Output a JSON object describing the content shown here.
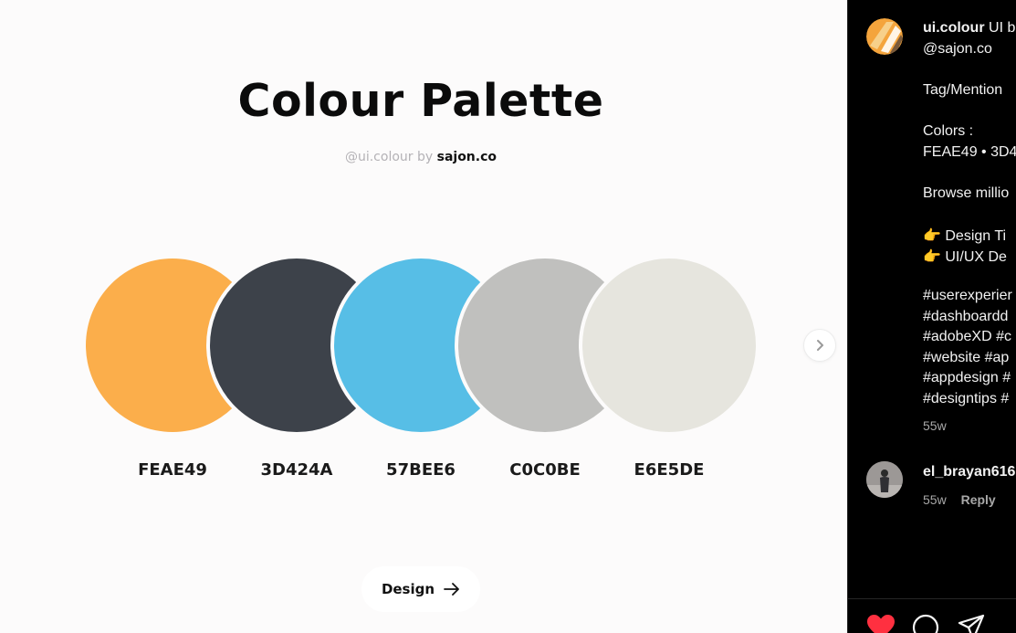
{
  "palette": {
    "title": "Colour Palette",
    "credit_handle": "@ui.colour by",
    "credit_brand": "sajon.co",
    "swatches": [
      {
        "hex": "FEAE49",
        "color": "#fbae4b"
      },
      {
        "hex": "3D424A",
        "color": "#3d424a"
      },
      {
        "hex": "57BEE6",
        "color": "#57bee6"
      },
      {
        "hex": "C0C0BE",
        "color": "#c0c0be"
      },
      {
        "hex": "E6E5DE",
        "color": "#e6e5de"
      }
    ],
    "design_button": "Design",
    "next_icon": "chevron-right-icon",
    "arrow_icon": "arrow-right-icon"
  },
  "caption": {
    "username": "ui.colour",
    "text_start": "UI b",
    "mention": "@sajon.co",
    "tag_line": "Tag/Mention",
    "colors_label": "Colors :",
    "colors_values": "FEAE49 • 3D4",
    "browse": "Browse millio",
    "tip1": "👉 Design Ti",
    "tip2": "👉 UI/UX De",
    "hashtags": [
      "#userexperier",
      "#dashboardd",
      "#adobeXD #c",
      "#website #ap",
      "#appdesign #",
      "#designtips #"
    ],
    "time": "55w"
  },
  "comment": {
    "username": "el_brayan616",
    "time": "55w",
    "reply": "Reply"
  },
  "actions": {
    "like_icon": "heart-icon",
    "comment_icon": "comment-icon",
    "share_icon": "share-icon"
  }
}
